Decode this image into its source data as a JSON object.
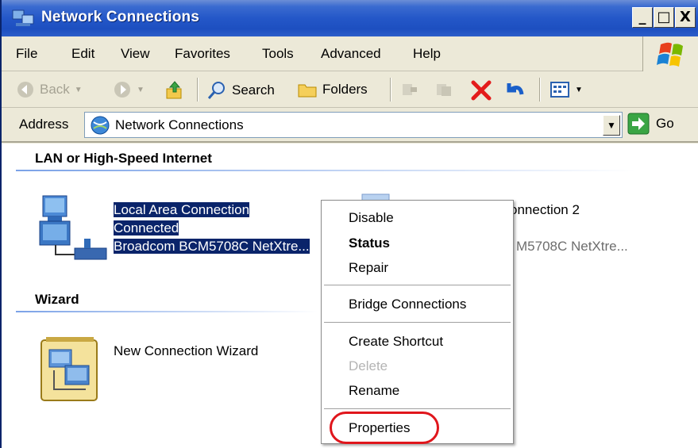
{
  "window": {
    "title": "Network Connections",
    "controls": {
      "minimize": "_",
      "maximize": "□",
      "close": "X"
    }
  },
  "menubar": {
    "items": [
      "File",
      "Edit",
      "View",
      "Favorites",
      "Tools",
      "Advanced",
      "Help"
    ]
  },
  "toolbar": {
    "back": "Back",
    "search": "Search",
    "folders": "Folders"
  },
  "address": {
    "label": "Address",
    "value": "Network Connections",
    "go": "Go"
  },
  "groups": {
    "lan_header": "LAN or High-Speed Internet",
    "wizard_header": "Wizard"
  },
  "connections": [
    {
      "name": "Local Area Connection",
      "status": "Connected",
      "device": "Broadcom BCM5708C NetXtre..."
    },
    {
      "name": "onnection 2",
      "device": "M5708C NetXtre..."
    }
  ],
  "wizard": {
    "label": "New Connection Wizard"
  },
  "context_menu": {
    "items": [
      {
        "label": "Disable",
        "state": "normal"
      },
      {
        "label": "Status",
        "state": "bold"
      },
      {
        "label": "Repair",
        "state": "normal"
      },
      {
        "label": "Bridge Connections",
        "state": "normal"
      },
      {
        "label": "Create Shortcut",
        "state": "normal"
      },
      {
        "label": "Delete",
        "state": "disabled"
      },
      {
        "label": "Rename",
        "state": "normal"
      },
      {
        "label": "Properties",
        "state": "normal"
      }
    ]
  },
  "colors": {
    "titlebar": "#2457c8",
    "selection": "#0a246a",
    "highlight_oval": "#e0161c"
  }
}
